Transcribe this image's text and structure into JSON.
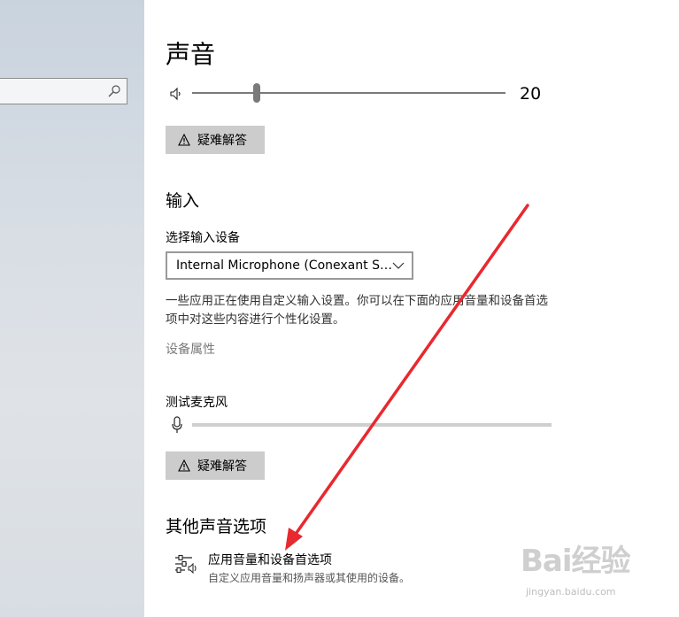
{
  "sidebar": {
    "search": {
      "placeholder": ""
    }
  },
  "sound": {
    "title": "声音",
    "volume": {
      "value": "20",
      "level": 0.2
    },
    "troubleshoot_label": "疑难解答"
  },
  "input": {
    "heading": "输入",
    "select_label": "选择输入设备",
    "selected_device": "Internal Microphone (Conexant S…",
    "description": "一些应用正在使用自定义输入设置。你可以在下面的应用音量和设备首选项中对这些内容进行个性化设置。",
    "device_properties": "设备属性",
    "test_label": "测试麦克风",
    "mic_level": 0,
    "troubleshoot_label": "疑难解答"
  },
  "other": {
    "heading": "其他声音选项",
    "app_volume": {
      "title": "应用音量和设备首选项",
      "subtitle": "自定义应用音量和扬声器或其使用的设备。"
    }
  },
  "watermark": {
    "brand": "Bai经验",
    "url": "jingyan.baidu.com"
  },
  "colors": {
    "arrow": "#e8292f",
    "button_bg": "#cccccc",
    "slider": "#7a7a7a"
  }
}
